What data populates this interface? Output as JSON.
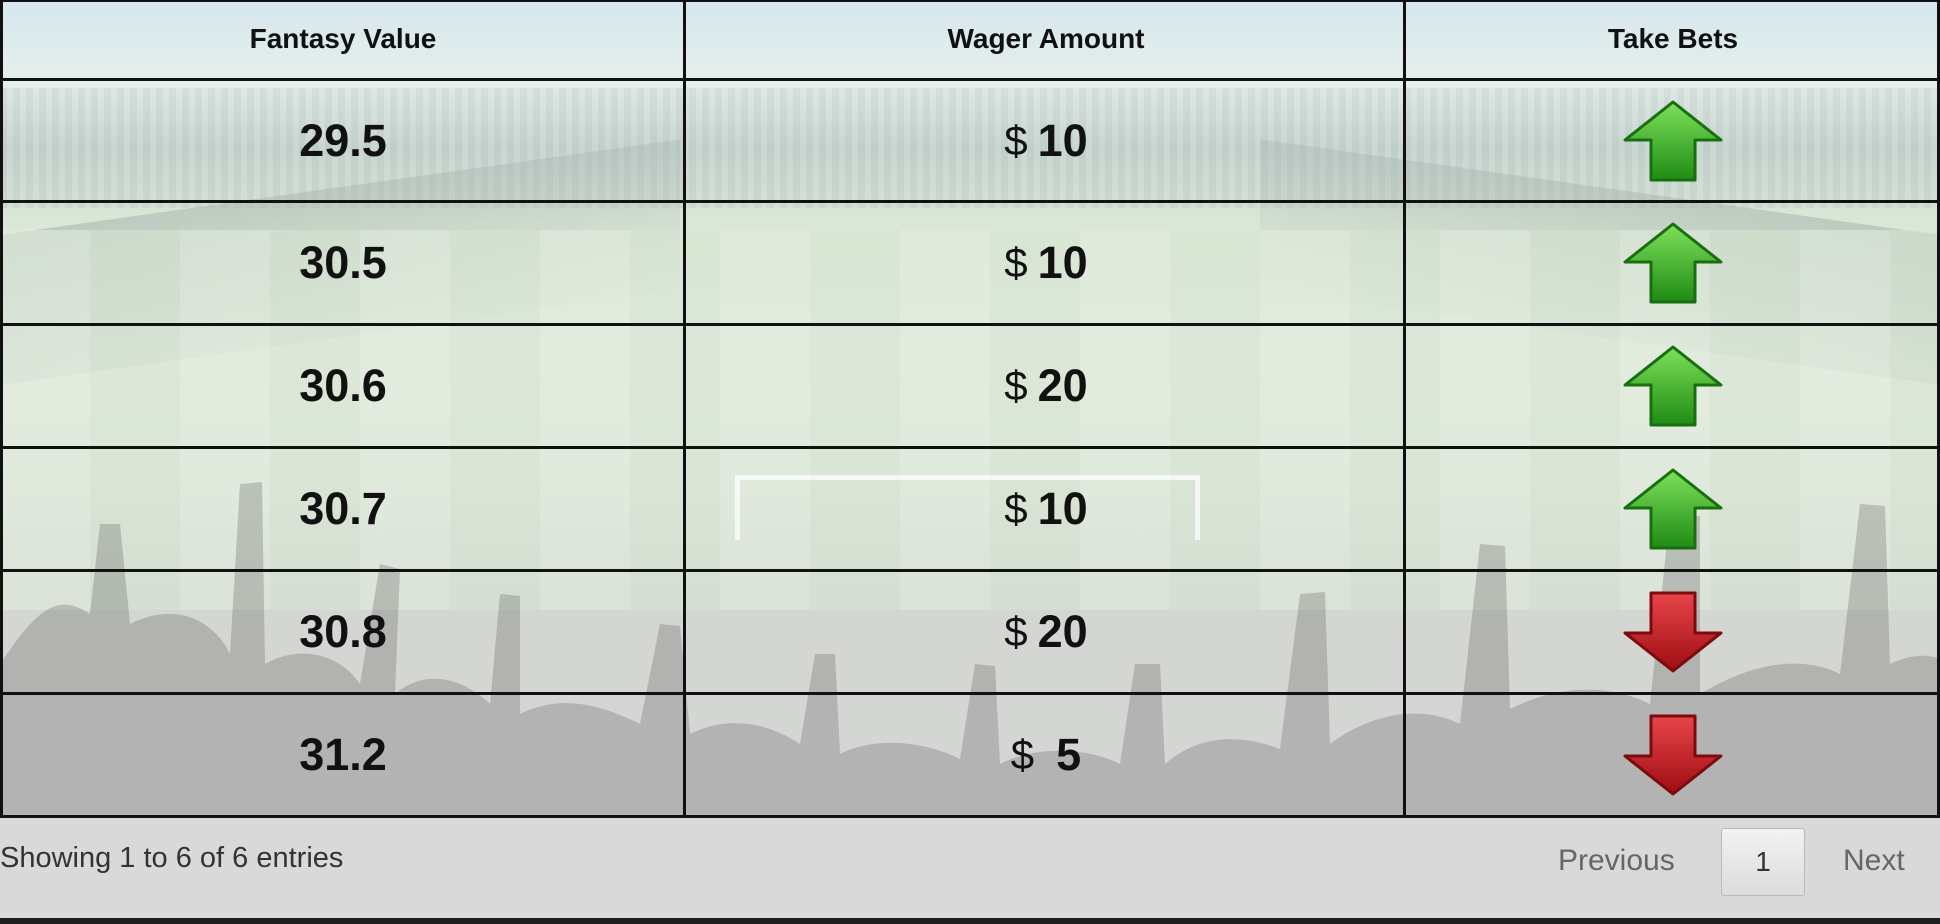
{
  "table": {
    "headers": [
      "Fantasy Value",
      "Wager Amount",
      "Take Bets"
    ],
    "currency_symbol": "$",
    "rows": [
      {
        "fantasy_value": "29.5",
        "wager": "10",
        "bet": "up-arrow-icon"
      },
      {
        "fantasy_value": "30.5",
        "wager": "10",
        "bet": "up-arrow-icon"
      },
      {
        "fantasy_value": "30.6",
        "wager": "20",
        "bet": "up-arrow-icon"
      },
      {
        "fantasy_value": "30.7",
        "wager": "10",
        "bet": "up-arrow-icon"
      },
      {
        "fantasy_value": "30.8",
        "wager": "20",
        "bet": "down-arrow-icon"
      },
      {
        "fantasy_value": "31.2",
        "wager": "5",
        "bet": "down-arrow-icon"
      }
    ]
  },
  "footer": {
    "info": "Showing 1 to 6 of 6 entries",
    "previous_label": "Previous",
    "current_page": "1",
    "next_label": "Next"
  },
  "colors": {
    "up_arrow": "#3fae2a",
    "down_arrow": "#c8161b",
    "grid_line": "#111111",
    "footer_bg": "#d9d9d9"
  }
}
